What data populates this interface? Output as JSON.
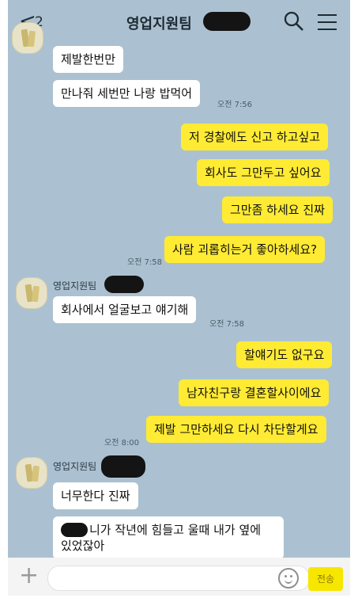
{
  "header": {
    "back_label": "<",
    "unread_count": "2",
    "title": "영업지원팀",
    "icons": {
      "back": "chevron-left-icon",
      "search": "search-icon",
      "menu": "menu-icon"
    }
  },
  "messages": {
    "m1": "제발한번만",
    "m2": "만나줘 세번만 나랑 밥먹어",
    "t1": "오전 7:56",
    "m3": "저 경찰에도 신고 하고싶고",
    "m4": "회사도 그만두고 싶어요",
    "m5": "그만좀 하세요 진짜",
    "m6": "사람 괴롭히는거 좋아하세요?",
    "t2": "오전 7:58",
    "sender1": "영업지원팀",
    "m7": "회사에서 얼굴보고 얘기해",
    "t3": "오전 7:58",
    "m8": "할얘기도 없구요",
    "m9": "남자친구랑 결혼할사이에요",
    "m10": "제발 그만하세요 다시 차단할게요",
    "t4": "오전 8:00",
    "sender2": "영업지원팀",
    "m11": "너무한다 진짜",
    "m12a": "니가 작년에 힘들고 울때 내가 옆에",
    "m12b": "있었잖아"
  },
  "input": {
    "value": "",
    "send_label": "전송",
    "icons": {
      "add": "plus-icon",
      "emoji": "emoji-icon"
    }
  },
  "colors": {
    "chat_background": "#abc1d1",
    "incoming_bubble": "#ffffff",
    "outgoing_bubble": "#ffeb33",
    "send_button": "#f7e600"
  }
}
